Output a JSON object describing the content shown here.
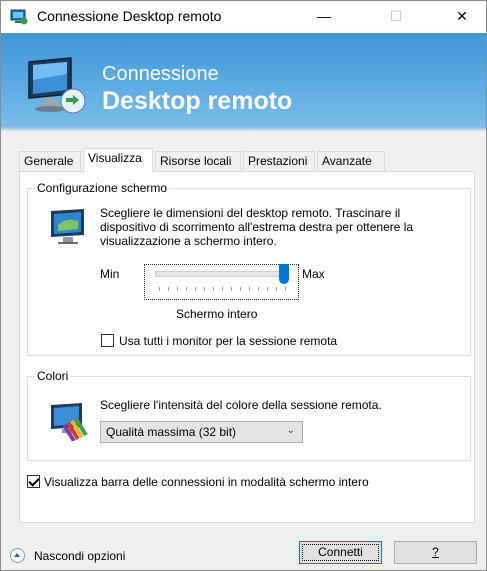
{
  "window": {
    "title": "Connessione Desktop remoto",
    "min_glyph": "—",
    "max_glyph": "☐",
    "close_glyph": "✕"
  },
  "banner": {
    "line1": "Connessione",
    "line2": "Desktop remoto"
  },
  "tabs": [
    {
      "label": "Generale",
      "active": false
    },
    {
      "label": "Visualizza",
      "active": true
    },
    {
      "label": "Risorse locali",
      "active": false
    },
    {
      "label": "Prestazioni",
      "active": false
    },
    {
      "label": "Avanzate",
      "active": false
    }
  ],
  "display_config": {
    "group_title": "Configurazione schermo",
    "description": "Scegliere le dimensioni del desktop remoto. Trascinare il dispositivo di scorrimento all'estrema destra per ottenere la visualizzazione a schermo intero.",
    "min_label": "Min",
    "max_label": "Max",
    "slider_value_fraction": 1.0,
    "size_label": "Schermo intero",
    "all_monitors_label": "Usa tutti i monitor per la sessione remota",
    "all_monitors_checked": false
  },
  "colors": {
    "group_title": "Colori",
    "description": "Scegliere l'intensità del colore della sessione remota.",
    "selected_option": "Qualità massima (32 bit)"
  },
  "connection_bar": {
    "label": "Visualizza barra delle connessioni in modalità schermo intero",
    "checked": true
  },
  "footer": {
    "hide_options": "Nascondi opzioni",
    "connect": "Connetti",
    "help": "?"
  },
  "accent_color": "#0078d7"
}
